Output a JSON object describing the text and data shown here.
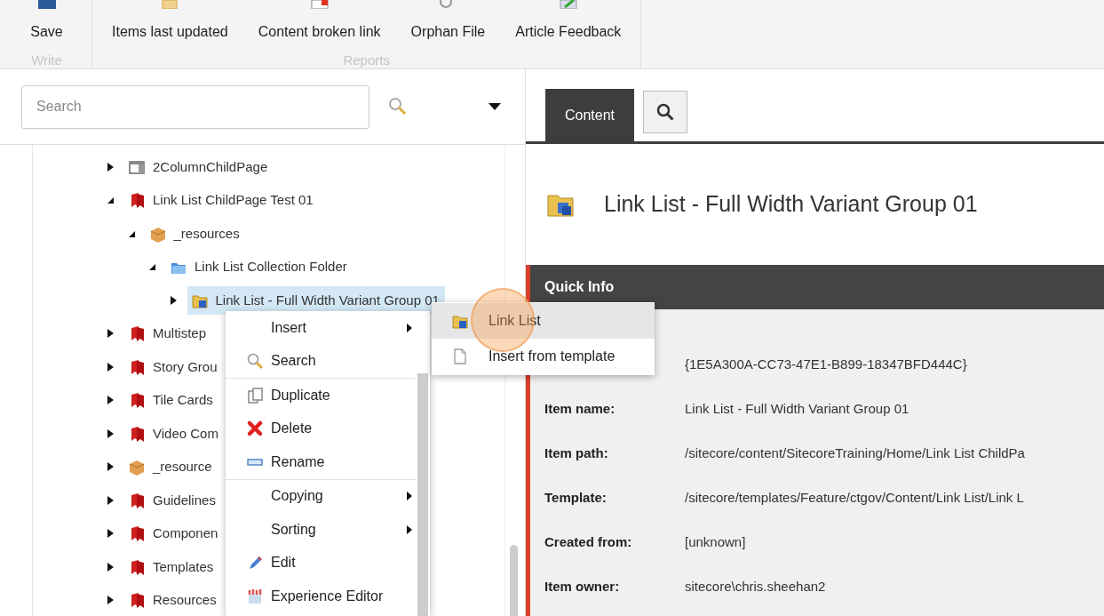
{
  "ribbon": {
    "groups": [
      {
        "label": "Write",
        "buttons": [
          "Save"
        ]
      },
      {
        "label": "Reports",
        "buttons": [
          "Items last updated",
          "Content broken link",
          "Orphan File",
          "Article Feedback"
        ]
      }
    ]
  },
  "search": {
    "placeholder": "Search"
  },
  "tree": [
    {
      "label": "2ColumnChildPage",
      "kind": "layout",
      "expanded": false,
      "selected": false
    },
    {
      "label": "Link List ChildPage Test 01",
      "kind": "page",
      "expanded": true,
      "selected": false,
      "children": [
        {
          "label": "_resources",
          "kind": "box",
          "expanded": true,
          "selected": false,
          "children": [
            {
              "label": "Link List Collection Folder",
              "kind": "folder",
              "expanded": true,
              "selected": false,
              "children": [
                {
                  "label": "Link List - Full Width Variant Group 01",
                  "kind": "link-list",
                  "expanded": false,
                  "selected": true
                }
              ]
            }
          ]
        }
      ]
    },
    {
      "label": "Multistep",
      "kind": "page",
      "expanded": false,
      "selected": false
    },
    {
      "label": "Story Grou",
      "kind": "page",
      "expanded": false,
      "selected": false
    },
    {
      "label": "Tile Cards",
      "kind": "page",
      "expanded": false,
      "selected": false
    },
    {
      "label": "Video Com",
      "kind": "page",
      "expanded": false,
      "selected": false
    },
    {
      "label": "_resource",
      "kind": "box",
      "expanded": false,
      "selected": false
    },
    {
      "label": "Guidelines",
      "kind": "page",
      "expanded": false,
      "selected": false
    },
    {
      "label": "Componen",
      "kind": "page",
      "expanded": false,
      "selected": false
    },
    {
      "label": "Templates",
      "kind": "page",
      "expanded": false,
      "selected": false
    },
    {
      "label": "Resources",
      "kind": "page",
      "expanded": false,
      "selected": false
    }
  ],
  "context_menu": {
    "items": [
      {
        "label": "Insert",
        "kind": "submenu"
      },
      {
        "label": "Search",
        "kind": "command"
      },
      {
        "kind": "separator"
      },
      {
        "label": "Duplicate",
        "kind": "command"
      },
      {
        "label": "Delete",
        "kind": "command"
      },
      {
        "label": "Rename",
        "kind": "command"
      },
      {
        "kind": "separator"
      },
      {
        "label": "Copying",
        "kind": "submenu"
      },
      {
        "label": "Sorting",
        "kind": "submenu"
      },
      {
        "label": "Edit",
        "kind": "command"
      },
      {
        "label": "Experience Editor",
        "kind": "command"
      }
    ],
    "submenu": [
      {
        "label": "Link List",
        "selected": true
      },
      {
        "label": "Insert from template",
        "selected": false
      }
    ]
  },
  "tabs": [
    {
      "label": "Content",
      "selected": true
    }
  ],
  "item_title": "Link List - Full Width Variant Group 01",
  "quick_info": {
    "title": "Quick Info",
    "fields": [
      {
        "value": "{1E5A300A-CC73-47E1-B899-18347BFD444C}"
      },
      {
        "label": "Item name:",
        "value": "Link List - Full Width Variant Group 01"
      },
      {
        "label": "Item path:",
        "value": "/sitecore/content/SitecoreTraining/Home/Link List ChildPa"
      },
      {
        "label": "Template:",
        "value": "/sitecore/templates/Feature/ctgov/Content/Link List/Link L"
      },
      {
        "label": "Created from:",
        "value": "[unknown]"
      },
      {
        "label": "Item owner:",
        "value": "sitecore\\chris.sheehan2"
      }
    ]
  }
}
